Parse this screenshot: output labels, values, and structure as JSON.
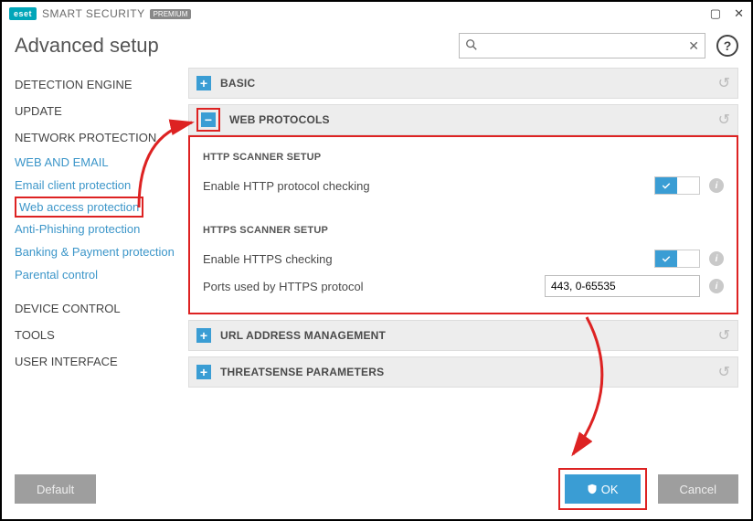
{
  "app": {
    "brand": "eset",
    "product": "SMART SECURITY",
    "edition": "PREMIUM"
  },
  "page_title": "Advanced setup",
  "search": {
    "placeholder": ""
  },
  "nav": {
    "main": [
      {
        "label": "DETECTION ENGINE"
      },
      {
        "label": "UPDATE"
      },
      {
        "label": "NETWORK PROTECTION"
      }
    ],
    "sub_group_title": "WEB AND EMAIL",
    "subs": [
      {
        "label": "Email client protection"
      },
      {
        "label": "Web access protection"
      },
      {
        "label": "Anti-Phishing protection"
      },
      {
        "label": "Banking & Payment protection"
      },
      {
        "label": "Parental control"
      }
    ],
    "tail": [
      {
        "label": "DEVICE CONTROL"
      },
      {
        "label": "TOOLS"
      },
      {
        "label": "USER INTERFACE"
      }
    ]
  },
  "sections": {
    "basic": {
      "title": "BASIC"
    },
    "web_protocols": {
      "title": "WEB PROTOCOLS",
      "http": {
        "header": "HTTP SCANNER SETUP",
        "enable_label": "Enable HTTP protocol checking",
        "enable_value": true
      },
      "https": {
        "header": "HTTPS SCANNER SETUP",
        "enable_label": "Enable HTTPS checking",
        "enable_value": true,
        "ports_label": "Ports used by HTTPS protocol",
        "ports_value": "443, 0-65535"
      }
    },
    "url_mgmt": {
      "title": "URL ADDRESS MANAGEMENT"
    },
    "threatsense": {
      "title": "THREATSENSE PARAMETERS"
    }
  },
  "footer": {
    "default": "Default",
    "ok": "OK",
    "cancel": "Cancel"
  }
}
